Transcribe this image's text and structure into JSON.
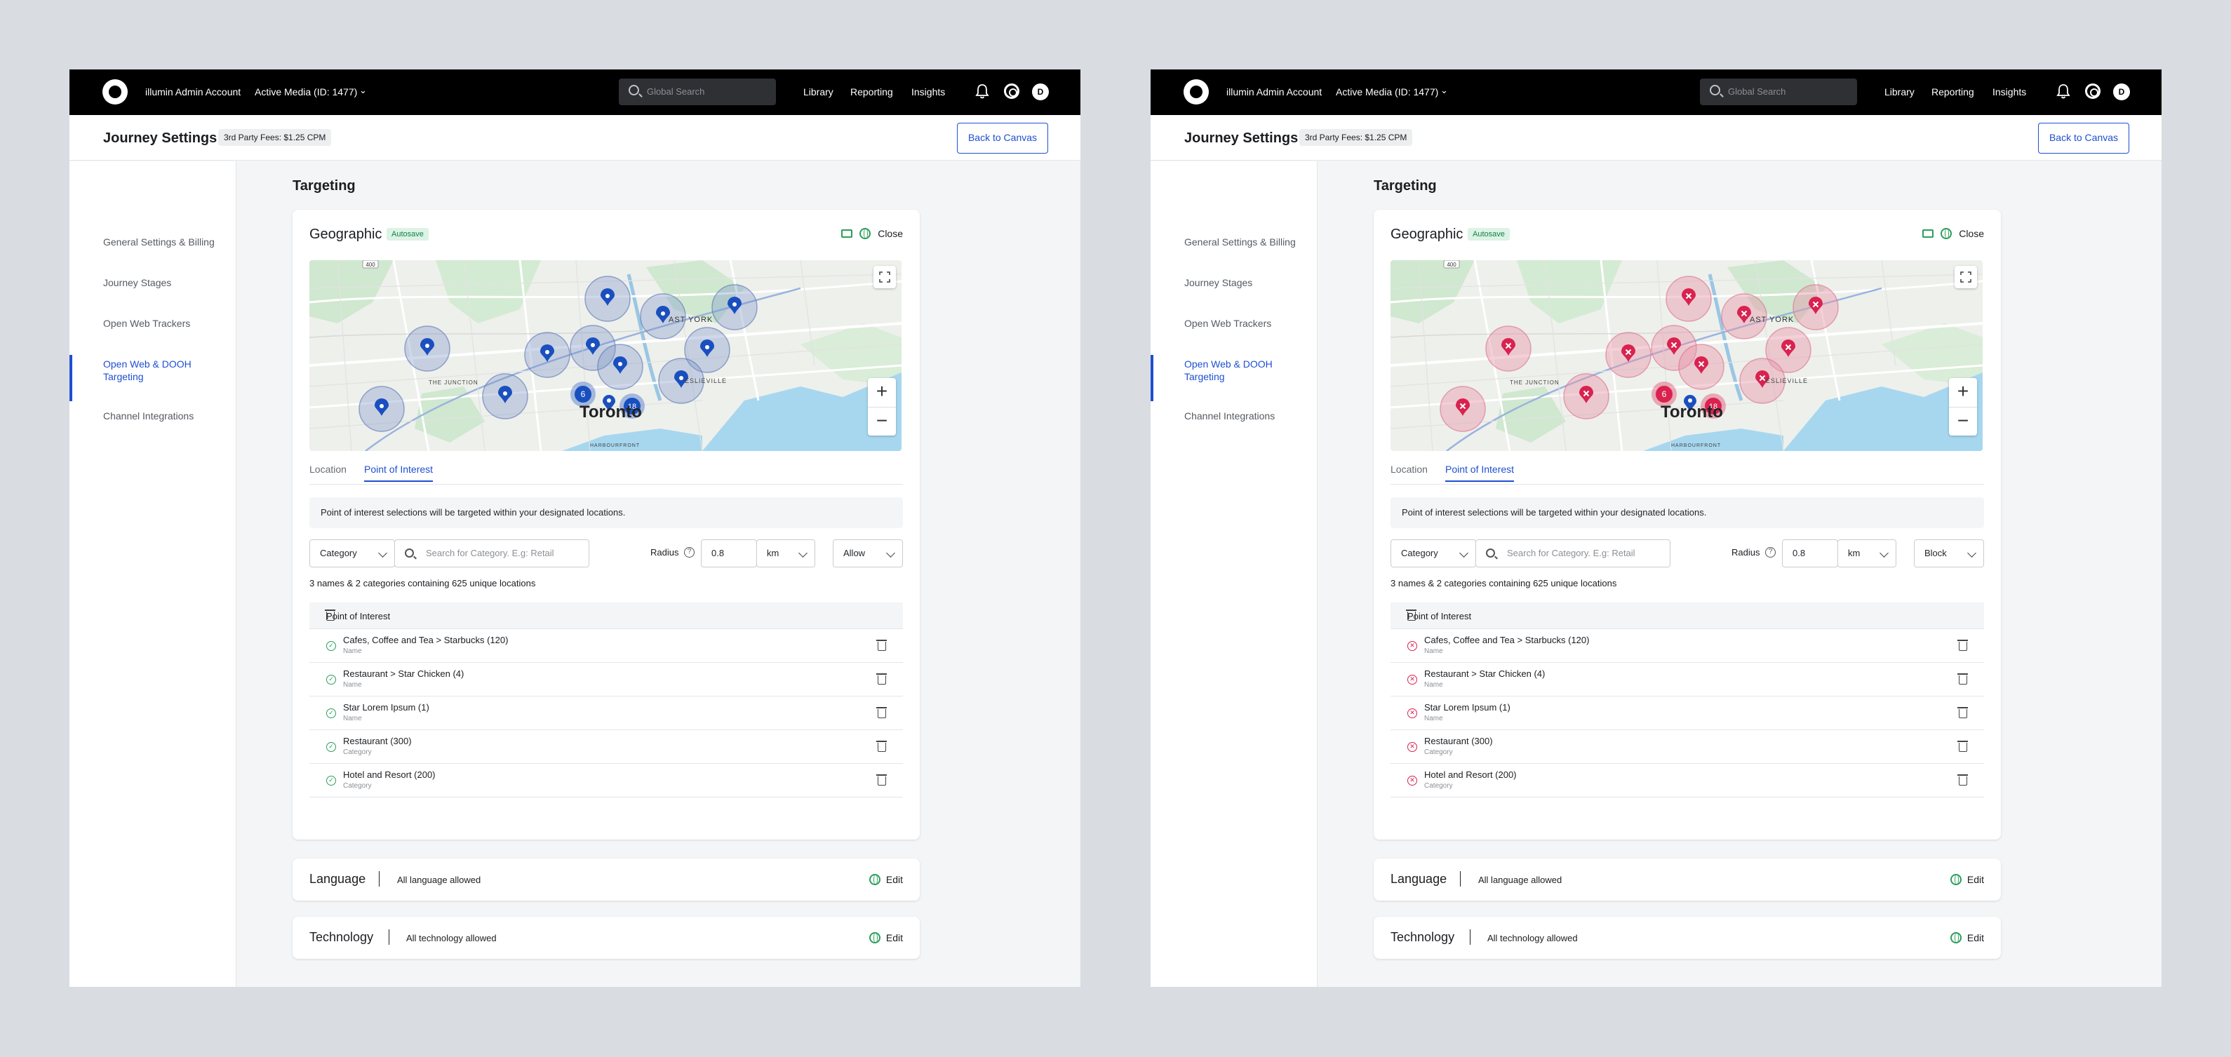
{
  "screens": [
    {
      "topbar": {
        "account": "illumin Admin Account",
        "media": "Active Media (ID: 1477)",
        "search_placeholder": "Global Search",
        "nav": [
          "Library",
          "Reporting",
          "Insights"
        ],
        "avatar": "D"
      },
      "subheader": {
        "title": "Journey Settings",
        "fees": "3rd Party Fees: $1.25 CPM",
        "back": "Back to Canvas"
      },
      "sidebar": [
        "General Settings & Billing",
        "Journey Stages",
        "Open Web Trackers",
        "Open Web & DOOH Targeting",
        "Channel Integrations"
      ],
      "section_title": "Targeting",
      "geo": {
        "title": "Geographic",
        "badge": "Autosave",
        "close": "Close"
      },
      "map_labels": {
        "east_york": "AST YORK",
        "junction": "THE JUNCTION",
        "leslieville": "ESLIEVILLE",
        "toronto": "Toronto",
        "harbourfront": "HARBOURFRONT",
        "route": "400",
        "cluster_a": "6",
        "cluster_b": "18"
      },
      "tabs": [
        "Location",
        "Point of Interest"
      ],
      "notice": "Point of interest selections will be targeted within your designated locations.",
      "filters": {
        "category": "Category",
        "search_placeholder": "Search for Category. E.g: Retail",
        "radius_label": "Radius",
        "radius_value": "0.8",
        "unit": "km",
        "mode": "Allow"
      },
      "summary": "3 names & 2 categories containing 625 unique locations",
      "poi_header": "Point of Interest",
      "poi_rows": [
        {
          "name": "Cafes, Coffee and Tea > Starbucks (120)",
          "type": "Name"
        },
        {
          "name": "Restaurant > Star Chicken (4)",
          "type": "Name"
        },
        {
          "name": "Star Lorem Ipsum (1)",
          "type": "Name"
        },
        {
          "name": "Restaurant (300)",
          "type": "Category"
        },
        {
          "name": "Hotel and Resort (200)",
          "type": "Category"
        }
      ],
      "language": {
        "title": "Language",
        "value": "All language allowed",
        "edit": "Edit"
      },
      "technology": {
        "title": "Technology",
        "value": "All technology allowed",
        "edit": "Edit"
      },
      "marker_color": "#1a4fbf",
      "status_kind": "allow"
    },
    {
      "topbar": {
        "account": "illumin Admin Account",
        "media": "Active Media (ID: 1477)",
        "search_placeholder": "Global Search",
        "nav": [
          "Library",
          "Reporting",
          "Insights"
        ],
        "avatar": "D"
      },
      "subheader": {
        "title": "Journey Settings",
        "fees": "3rd Party Fees: $1.25 CPM",
        "back": "Back to Canvas"
      },
      "sidebar": [
        "General Settings & Billing",
        "Journey Stages",
        "Open Web Trackers",
        "Open Web & DOOH Targeting",
        "Channel Integrations"
      ],
      "section_title": "Targeting",
      "geo": {
        "title": "Geographic",
        "badge": "Autosave",
        "close": "Close"
      },
      "map_labels": {
        "east_york": "AST YORK",
        "junction": "THE JUNCTION",
        "leslieville": "ESLIEVILLE",
        "toronto": "Toronto",
        "harbourfront": "HARBOURFRONT",
        "route": "400",
        "cluster_a": "6",
        "cluster_b": "18"
      },
      "tabs": [
        "Location",
        "Point of Interest"
      ],
      "notice": "Point of interest selections will be targeted within your designated locations.",
      "filters": {
        "category": "Category",
        "search_placeholder": "Search for Category. E.g: Retail",
        "radius_label": "Radius",
        "radius_value": "0.8",
        "unit": "km",
        "mode": "Block"
      },
      "summary": "3 names & 2 categories containing 625 unique locations",
      "poi_header": "Point of Interest",
      "poi_rows": [
        {
          "name": "Cafes, Coffee and Tea > Starbucks (120)",
          "type": "Name"
        },
        {
          "name": "Restaurant > Star Chicken (4)",
          "type": "Name"
        },
        {
          "name": "Star Lorem Ipsum (1)",
          "type": "Name"
        },
        {
          "name": "Restaurant (300)",
          "type": "Category"
        },
        {
          "name": "Hotel and Resort (200)",
          "type": "Category"
        }
      ],
      "language": {
        "title": "Language",
        "value": "All language allowed",
        "edit": "Edit"
      },
      "technology": {
        "title": "Technology",
        "value": "All technology allowed",
        "edit": "Edit"
      },
      "marker_color": "#d9224f",
      "status_kind": "block"
    }
  ]
}
